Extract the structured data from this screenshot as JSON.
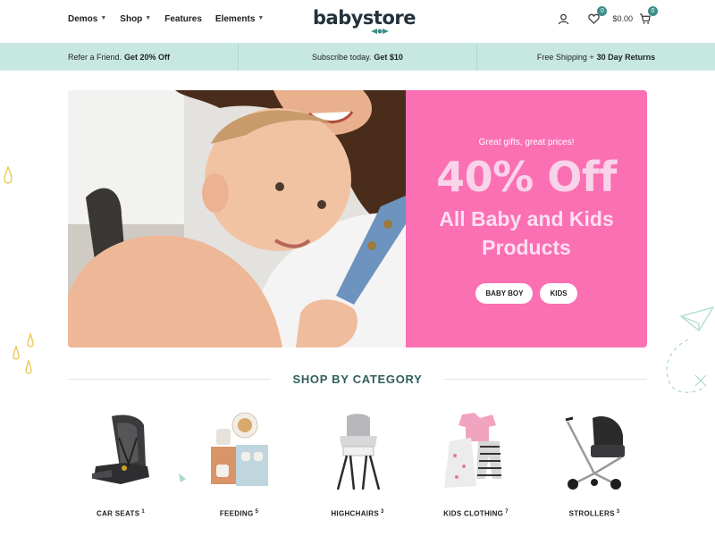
{
  "header": {
    "logo": "babystore",
    "nav": [
      {
        "label": "Demos",
        "dropdown": true
      },
      {
        "label": "Shop",
        "dropdown": true
      },
      {
        "label": "Features",
        "dropdown": false
      },
      {
        "label": "Elements",
        "dropdown": true
      }
    ],
    "wishlist_count": "0",
    "cart_total": "$0.00",
    "cart_count": "0"
  },
  "promo": [
    {
      "text": "Refer a Friend.",
      "bold": "Get 20% Off"
    },
    {
      "text": "Subscribe today.",
      "bold": "Get $10"
    },
    {
      "text": "Free Shipping +",
      "bold": "30 Day Returns"
    }
  ],
  "hero": {
    "subtitle": "Great gifts, great prices!",
    "headline": "40% Off",
    "line1": "All Baby and Kids",
    "line2": "Products",
    "buttons": [
      "BABY BOY",
      "KIDS"
    ]
  },
  "section": {
    "title": "SHOP BY CATEGORY"
  },
  "categories": [
    {
      "name": "CAR SEATS",
      "count": "1"
    },
    {
      "name": "FEEDING",
      "count": "5"
    },
    {
      "name": "HIGHCHAIRS",
      "count": "3"
    },
    {
      "name": "KIDS CLOTHING",
      "count": "7"
    },
    {
      "name": "STROLLERS",
      "count": "3"
    }
  ],
  "colors": {
    "accent": "#3e8d8a",
    "promo_bg": "#c7e8e1",
    "hero_pink": "#fb6fb3",
    "section_title": "#2f5f5c"
  },
  "icons": [
    "user-icon",
    "heart-icon",
    "cart-icon",
    "chevron-down-icon"
  ]
}
